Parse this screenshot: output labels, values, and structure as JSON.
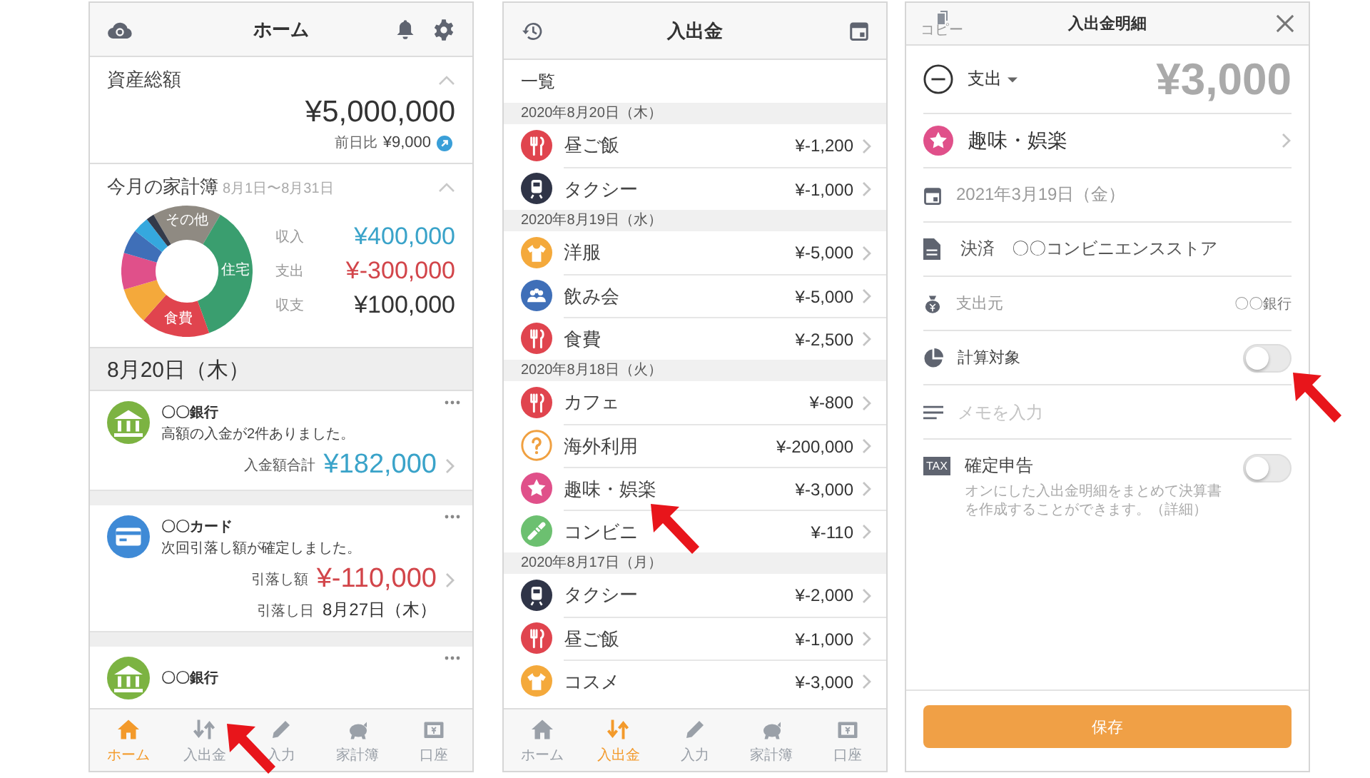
{
  "home": {
    "header": {
      "title": "ホーム"
    },
    "assets": {
      "label": "資産総額",
      "amount": "¥5,000,000",
      "compare_label": "前日比",
      "compare_value": "¥9,000"
    },
    "budget": {
      "title": "今月の家計簿",
      "period": "8月1日〜8月31日",
      "donut_labels": [
        "その他",
        "住宅",
        "食費"
      ],
      "rows": [
        {
          "label": "収入",
          "value": "¥400,000",
          "color": "#3aa3c9"
        },
        {
          "label": "支出",
          "value": "¥-300,000",
          "color": "#d2454a"
        },
        {
          "label": "収支",
          "value": "¥100,000",
          "color": "#333333"
        }
      ]
    },
    "date": "8月20日（木）",
    "cards": [
      {
        "kind": "bank",
        "title": "〇〇銀行",
        "message": "高額の入金が2件ありました。",
        "amount_label": "入金額合計",
        "amount": "¥182,000",
        "color": "#3aa3c9"
      },
      {
        "kind": "card",
        "title": "〇〇カード",
        "message": "次回引落し額が確定しました。",
        "amount_label": "引落し額",
        "amount": "¥-110,000",
        "color": "#d2454a",
        "due_label": "引落し日",
        "due": "8月27日（木）"
      },
      {
        "kind": "bank",
        "title": "〇〇銀行"
      }
    ],
    "tabs": [
      {
        "label": "ホーム",
        "selected": true
      },
      {
        "label": "入出金",
        "selected": false
      },
      {
        "label": "入力",
        "selected": false
      },
      {
        "label": "家計簿",
        "selected": false
      },
      {
        "label": "口座",
        "selected": false
      }
    ]
  },
  "transactions": {
    "header": {
      "title": "入出金"
    },
    "section": "一覧",
    "groups": [
      {
        "date": "2020年8月20日（木）",
        "items": [
          {
            "kind": "food",
            "color": "#e0444e",
            "name": "昼ご飯",
            "amount": "¥-1,200"
          },
          {
            "kind": "transport",
            "color": "#2f3447",
            "name": "タクシー",
            "amount": "¥-1,000"
          }
        ]
      },
      {
        "date": "2020年8月19日（水）",
        "items": [
          {
            "kind": "clothes",
            "color": "#f4a93b",
            "name": "洋服",
            "amount": "¥-5,000"
          },
          {
            "kind": "party",
            "color": "#3f6fb8",
            "name": "飲み会",
            "amount": "¥-5,000"
          },
          {
            "kind": "food",
            "color": "#e0444e",
            "name": "食費",
            "amount": "¥-2,500"
          }
        ]
      },
      {
        "date": "2020年8月18日（火）",
        "items": [
          {
            "kind": "food",
            "color": "#e0444e",
            "name": "カフェ",
            "amount": "¥-800"
          },
          {
            "kind": "unknown",
            "color": "#f0a040",
            "name": "海外利用",
            "amount": "¥-200,000"
          },
          {
            "kind": "hobby",
            "color": "#e0508a",
            "name": "趣味・娯楽",
            "amount": "¥-3,000"
          },
          {
            "kind": "convenience",
            "color": "#6cc070",
            "name": "コンビニ",
            "amount": "¥-110"
          }
        ]
      },
      {
        "date": "2020年8月17日（月）",
        "items": [
          {
            "kind": "transport",
            "color": "#2f3447",
            "name": "タクシー",
            "amount": "¥-2,000"
          },
          {
            "kind": "food",
            "color": "#e0444e",
            "name": "昼ご飯",
            "amount": "¥-1,000"
          },
          {
            "kind": "clothes",
            "color": "#f4a93b",
            "name": "コスメ",
            "amount": "¥-3,000"
          }
        ]
      }
    ],
    "tabs": [
      {
        "label": "ホーム",
        "selected": false
      },
      {
        "label": "入出金",
        "selected": true
      },
      {
        "label": "入力",
        "selected": false
      },
      {
        "label": "家計簿",
        "selected": false
      },
      {
        "label": "口座",
        "selected": false
      }
    ]
  },
  "detail": {
    "header": {
      "copy": "コピー",
      "title": "入出金明細"
    },
    "type": "支出",
    "amount": "¥3,000",
    "category": {
      "name": "趣味・娯楽",
      "color": "#e0508a"
    },
    "date": "2021年3月19日（金）",
    "content": "決済　〇〇コンビニエンスストア",
    "source_label": "支出元",
    "source": "〇〇銀行",
    "calc": {
      "label": "計算対象",
      "on": false
    },
    "memo_placeholder": "メモを入力",
    "tax": {
      "badge": "TAX",
      "label": "確定申告",
      "on": false,
      "note": "オンにした入出金明細をまとめて決算書を作成することができます。（詳細）"
    },
    "save": "保存"
  }
}
